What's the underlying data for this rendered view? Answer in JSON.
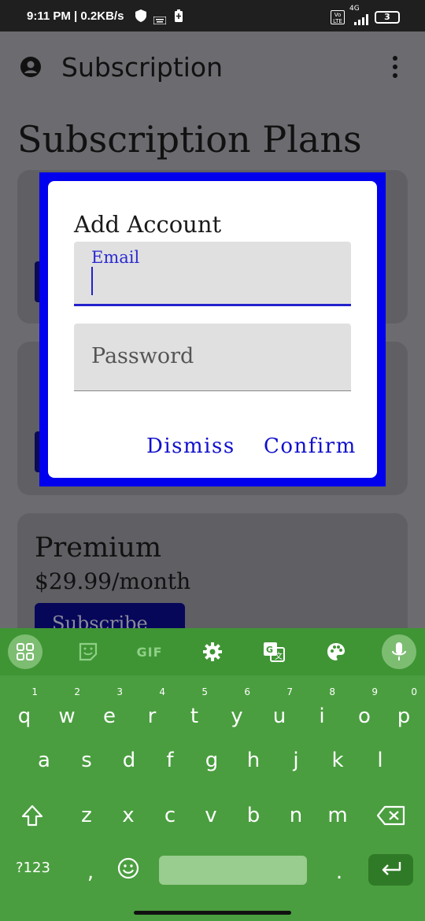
{
  "status_bar": {
    "time_speed": "9:11 PM | 0.2KB/s",
    "network": "4G",
    "volte": "Vo LTE",
    "battery": "3"
  },
  "app": {
    "title": "Subscription",
    "heading": "Subscription Plans",
    "plans": [
      {
        "name": "Premium",
        "price": "$29.99/month",
        "button": "Subscribe"
      }
    ]
  },
  "dialog": {
    "title": "Add Account",
    "email_label": "Email",
    "email_value": "",
    "password_placeholder": "Password",
    "dismiss_label": "Dismiss",
    "confirm_label": "Confirm",
    "frame_color": "#0000ee"
  },
  "keyboard": {
    "toolbar": [
      "apps-icon",
      "sticker-icon",
      "GIF",
      "gear-icon",
      "translate-icon",
      "palette-icon",
      "mic-icon"
    ],
    "row1": [
      {
        "k": "q",
        "h": "1"
      },
      {
        "k": "w",
        "h": "2"
      },
      {
        "k": "e",
        "h": "3"
      },
      {
        "k": "r",
        "h": "4"
      },
      {
        "k": "t",
        "h": "5"
      },
      {
        "k": "y",
        "h": "6"
      },
      {
        "k": "u",
        "h": "7"
      },
      {
        "k": "i",
        "h": "8"
      },
      {
        "k": "o",
        "h": "9"
      },
      {
        "k": "p",
        "h": "0"
      }
    ],
    "row2": [
      "a",
      "s",
      "d",
      "f",
      "g",
      "h",
      "j",
      "k",
      "l"
    ],
    "row3": [
      "z",
      "x",
      "c",
      "v",
      "b",
      "n",
      "m"
    ],
    "symbols_label": "?123",
    "comma": ",",
    "period": ".",
    "accent_color": "#4a9e3f"
  }
}
